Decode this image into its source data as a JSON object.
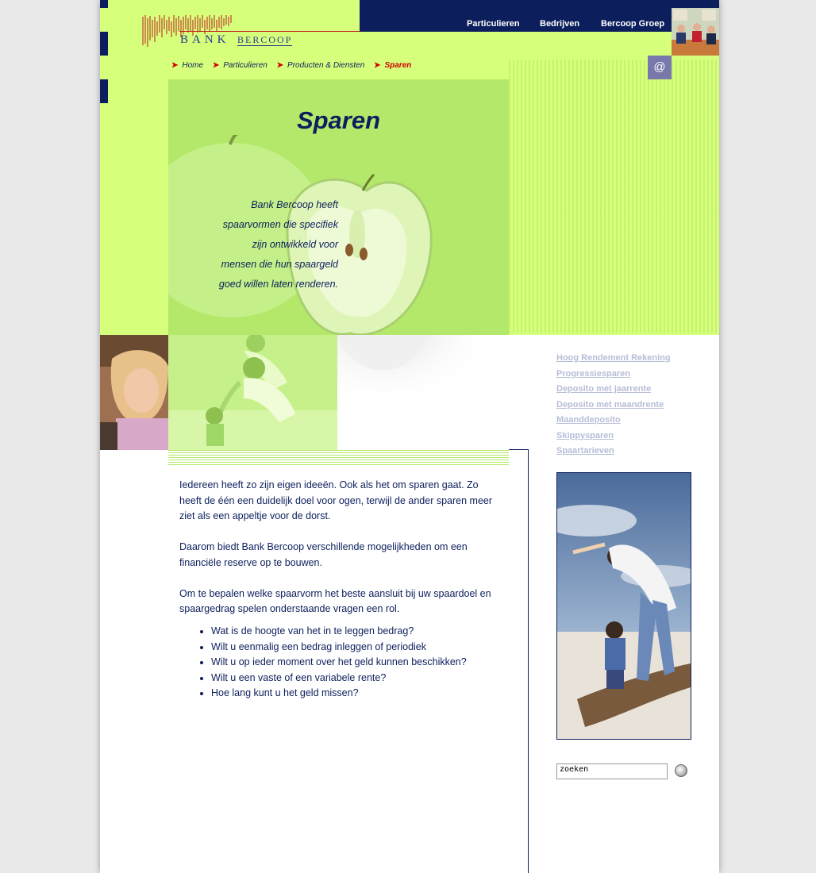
{
  "brand": {
    "bank": "BANK",
    "name": "BERCOOP"
  },
  "nav": {
    "items": [
      {
        "label": "Particulieren"
      },
      {
        "label": "Bedrijven"
      },
      {
        "label": "Bercoop Groep"
      }
    ]
  },
  "contact": {
    "symbol": "@"
  },
  "breadcrumb": {
    "items": [
      "Home",
      "Particulieren",
      "Producten & Diensten"
    ],
    "current": "Sparen",
    "arrow": "➤"
  },
  "hero": {
    "title": "Sparen",
    "text_lines": [
      "Bank Bercoop heeft",
      "spaarvormen die specifiek",
      "zijn ontwikkeld voor",
      "mensen die hun spaargeld",
      "goed willen laten renderen."
    ]
  },
  "content": {
    "paragraphs": [
      "Iedereen heeft zo zijn eigen ideeën. Ook als het om sparen gaat. Zo heeft de één een duidelijk doel voor ogen, terwijl de ander sparen meer ziet als een appeltje voor de dorst.",
      "Daarom biedt Bank Bercoop verschillende mogelijkheden om een financiële reserve op te bouwen.",
      "Om te bepalen welke spaarvorm het beste aansluit bij uw spaardoel en spaargedrag spelen onderstaande vragen een rol."
    ],
    "questions": [
      "Wat is de hoogte van het in te leggen bedrag?",
      "Wilt u eenmalig een bedrag inleggen of periodiek",
      "Wilt u op ieder moment over het geld kunnen beschikken?",
      "Wilt u een vaste of een variabele rente?",
      "Hoe lang kunt u het geld missen?"
    ]
  },
  "products": {
    "links": [
      "Hoog Rendement Rekening",
      "Progressiesparen",
      "Deposito met jaarrente",
      "Deposito met maandrente",
      "Maanddeposito",
      "Skippysparen",
      "Spaartarieven"
    ]
  },
  "search": {
    "value": "zoeken",
    "button_icon": "search-icon"
  },
  "colors": {
    "lime": "#d6ff7c",
    "navy": "#0c1f5c",
    "accent_red": "#d10000",
    "link_muted": "#b6bed8"
  }
}
